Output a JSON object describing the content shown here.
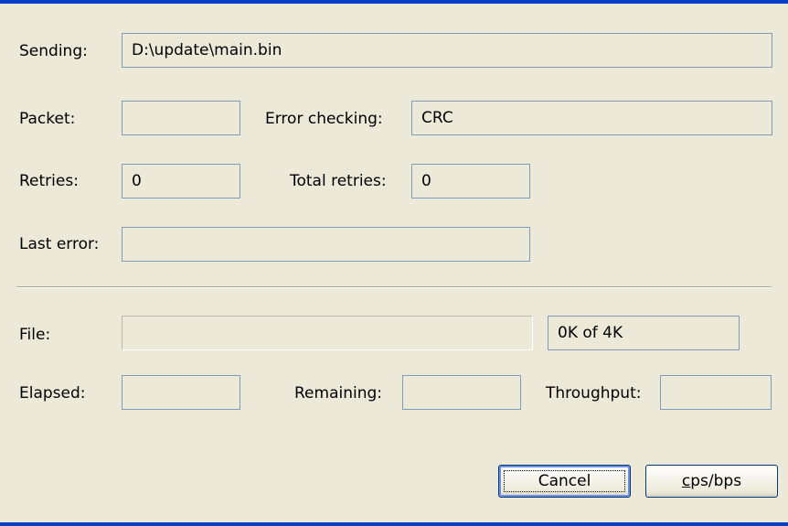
{
  "sending": {
    "label": "Sending:",
    "value": "D:\\update\\main.bin"
  },
  "packet": {
    "label": "Packet:",
    "value": ""
  },
  "error_checking": {
    "label": "Error checking:",
    "value": "CRC"
  },
  "retries": {
    "label": "Retries:",
    "value": "0"
  },
  "total_retries": {
    "label": "Total retries:",
    "value": "0"
  },
  "last_error": {
    "label": "Last error:",
    "value": ""
  },
  "file": {
    "label": "File:",
    "progress_fraction": 0,
    "size_text": "0K of 4K"
  },
  "elapsed": {
    "label": "Elapsed:",
    "value": ""
  },
  "remaining": {
    "label": "Remaining:",
    "value": ""
  },
  "throughput": {
    "label": "Throughput:",
    "value": ""
  },
  "buttons": {
    "cancel": "Cancel",
    "cps_bps_mnemonic": "c",
    "cps_bps_rest": "ps/bps"
  },
  "colors": {
    "window_bg": "#ece9d8",
    "field_border": "#7f9db9",
    "title_accent": "#0a3fc8",
    "button_border": "#003c74"
  }
}
